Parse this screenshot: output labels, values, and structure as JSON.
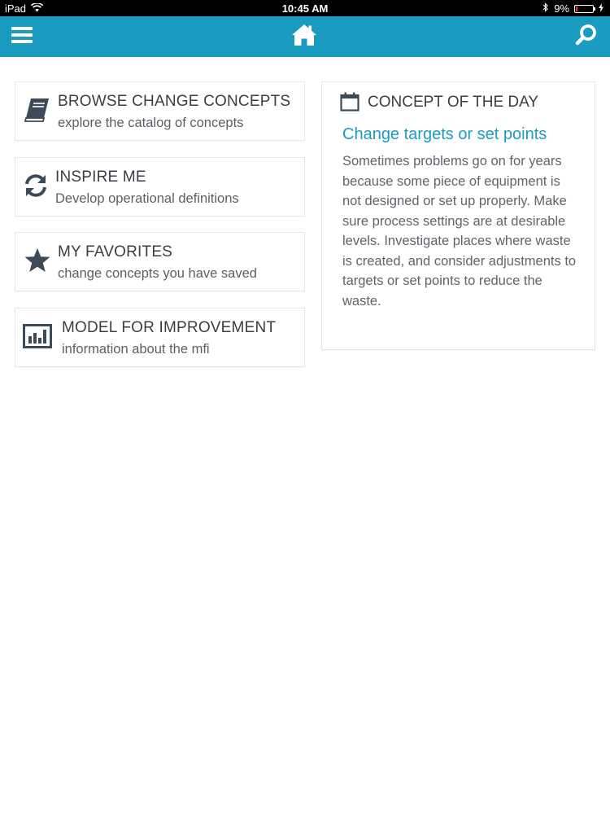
{
  "status_bar": {
    "device": "iPad",
    "time": "10:45 AM",
    "battery": "9%",
    "battery_level": 0.09
  },
  "navbar": {
    "menu_icon": "hamburger-menu-icon",
    "home_icon": "home-icon",
    "search_icon": "search-icon",
    "accent_color": "#1a9cc1"
  },
  "menu": [
    {
      "icon": "book-icon",
      "title": "BROWSE CHANGE CONCEPTS",
      "subtitle": "explore the catalog of concepts"
    },
    {
      "icon": "refresh-icon",
      "title": "INSPIRE ME",
      "subtitle": "Develop operational definitions"
    },
    {
      "icon": "star-icon",
      "title": "MY FAVORITES",
      "subtitle": "change concepts you have saved"
    },
    {
      "icon": "bar-chart-icon",
      "title": "MODEL FOR IMPROVEMENT",
      "subtitle": "information about the mfi"
    }
  ],
  "concept_of_day": {
    "heading": "CONCEPT OF THE DAY",
    "title": "Change targets or set points",
    "description": "Sometimes problems go on for years because some piece of equipment is not designed or set up properly. Make sure process settings are at desirable levels. Investigate places where waste is created, and consider adjustments to targets or set points to reduce the waste."
  }
}
